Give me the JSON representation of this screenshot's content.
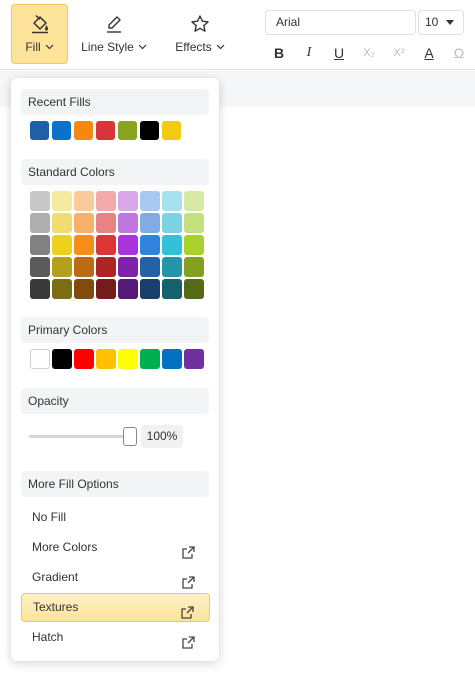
{
  "toolbar": {
    "fill_label": "Fill",
    "line_style_label": "Line Style",
    "effects_label": "Effects",
    "font_name": "Arial",
    "font_size": "10",
    "format_buttons": [
      "B",
      "I",
      "U",
      "X₂",
      "X²",
      "A",
      "Ω"
    ]
  },
  "panel": {
    "recent_fills_title": "Recent Fills",
    "recent_fills": [
      "#1f5fa8",
      "#0b72c9",
      "#f5880f",
      "#d6353a",
      "#88a421",
      "#000000",
      "#f2cb16"
    ],
    "standard_colors_title": "Standard Colors",
    "standard_colors": [
      [
        "#c8c8c8",
        "#f5eaa0",
        "#f9cb9b",
        "#f2a9a9",
        "#d9a7ea",
        "#a8c8ef",
        "#a7e1ef",
        "#d6eaa5"
      ],
      [
        "#aeaeae",
        "#f1dc6f",
        "#f7b16b",
        "#e78383",
        "#c078e0",
        "#82abe3",
        "#7dd2e3",
        "#c4df7e"
      ],
      [
        "#818181",
        "#ecd11e",
        "#f58d16",
        "#dc3535",
        "#a934dc",
        "#2f84dd",
        "#2fc2d9",
        "#a9d12c"
      ],
      [
        "#5a5a5a",
        "#b5a01c",
        "#bd6b12",
        "#ac2626",
        "#7e23aa",
        "#2362a8",
        "#2295a6",
        "#84a01f"
      ],
      [
        "#393939",
        "#7b6d12",
        "#804b0d",
        "#741b1b",
        "#551a75",
        "#183e6c",
        "#17606d",
        "#556a16"
      ]
    ],
    "primary_colors_title": "Primary Colors",
    "primary_colors": [
      "#ffffff",
      "#000000",
      "#ff0000",
      "#ffc000",
      "#ffff00",
      "#00b050",
      "#0070c0",
      "#7030a0"
    ],
    "opacity_title": "Opacity",
    "opacity_value": "100%",
    "opacity_level": 1.0,
    "more_fill_options_title": "More Fill Options",
    "options": [
      {
        "label": "No Fill",
        "external": false
      },
      {
        "label": "More Colors",
        "external": true
      },
      {
        "label": "Gradient",
        "external": true
      },
      {
        "label": "Textures",
        "external": true,
        "highlighted": true
      },
      {
        "label": "Hatch",
        "external": true
      }
    ]
  }
}
